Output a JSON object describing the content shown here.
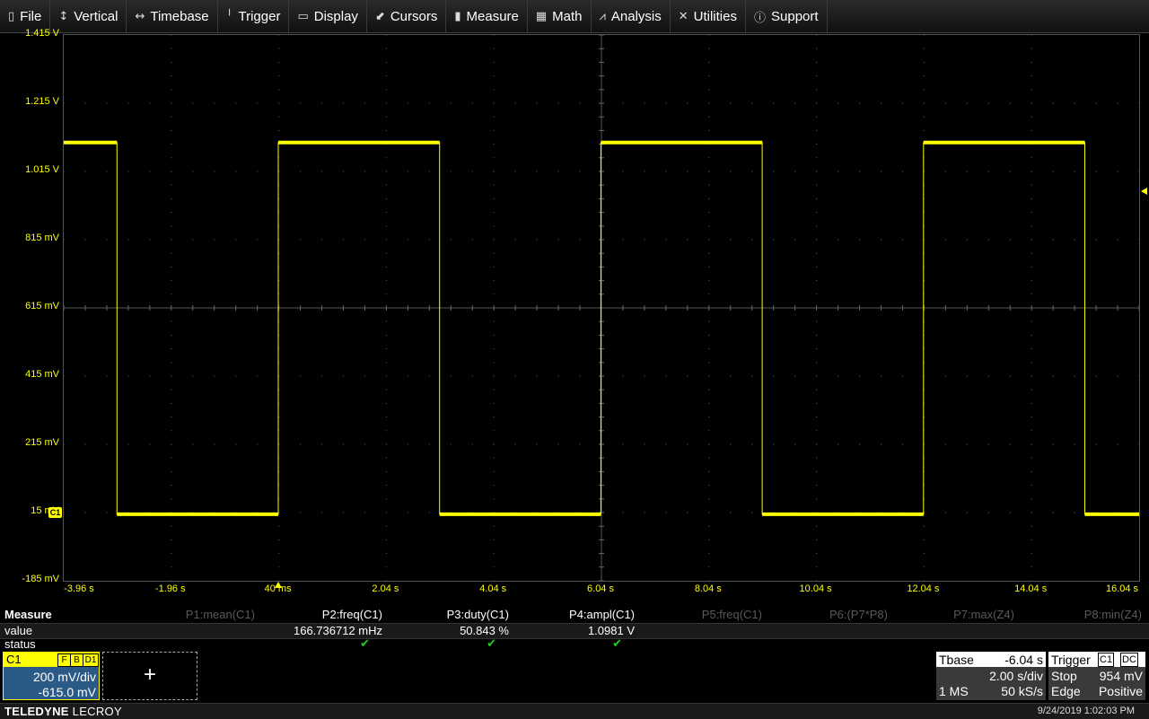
{
  "menu": [
    {
      "label": "File",
      "icon": "clipboard-icon",
      "glyph": "▯"
    },
    {
      "label": "Vertical",
      "icon": "vertical-arrows-icon",
      "glyph": "↕"
    },
    {
      "label": "Timebase",
      "icon": "horizontal-arrows-icon",
      "glyph": "↔"
    },
    {
      "label": "Trigger",
      "icon": "trigger-icon",
      "glyph": "╵"
    },
    {
      "label": "Display",
      "icon": "display-icon",
      "glyph": "▭"
    },
    {
      "label": "Cursors",
      "icon": "cursor-icon",
      "glyph": "⬋"
    },
    {
      "label": "Measure",
      "icon": "measure-icon",
      "glyph": "▮"
    },
    {
      "label": "Math",
      "icon": "calculator-icon",
      "glyph": "▦"
    },
    {
      "label": "Analysis",
      "icon": "analysis-chart-icon",
      "glyph": "⩘"
    },
    {
      "label": "Utilities",
      "icon": "wrench-icon",
      "glyph": "✕"
    },
    {
      "label": "Support",
      "icon": "info-icon",
      "glyph": "ⓘ"
    }
  ],
  "chart_data": {
    "type": "line",
    "y_tick_labels": [
      "1.415 V",
      "1.215 V",
      "1.015 V",
      "815 mV",
      "615 mV",
      "415 mV",
      "215 mV",
      "15 mV",
      "-185 mV"
    ],
    "x_tick_labels": [
      "-3.96 s",
      "-1.96 s",
      "40 ms",
      "2.04 s",
      "4.04 s",
      "6.04 s",
      "8.04 s",
      "10.04 s",
      "12.04 s",
      "14.04 s",
      "16.04 s"
    ],
    "xlim": [
      -3.96,
      16.04
    ],
    "ylim": [
      -0.185,
      1.415
    ],
    "series": [
      {
        "color": "#ffff00",
        "x": [
          -3.96,
          -2.97,
          -2.97,
          0.03,
          0.03,
          3.03,
          3.03,
          6.03,
          6.03,
          9.03,
          9.03,
          12.03,
          12.03,
          15.03,
          15.03,
          16.04
        ],
        "y": [
          1.1,
          1.1,
          0.01,
          0.01,
          1.1,
          1.1,
          0.01,
          0.01,
          1.1,
          1.1,
          0.01,
          0.01,
          1.1,
          1.1,
          0.01,
          0.01
        ]
      }
    ],
    "grid": true,
    "trace_color": "#ffff00"
  },
  "markers": {
    "channel_offset_label": "C1"
  },
  "measure": {
    "title": "Measure",
    "row_value_label": "value",
    "row_status_label": "status",
    "params": [
      {
        "name": "P1:mean(C1)",
        "value": "",
        "status": false,
        "active": false
      },
      {
        "name": "P2:freq(C1)",
        "value": "166.736712 mHz",
        "status": true,
        "active": true
      },
      {
        "name": "P3:duty(C1)",
        "value": "50.843 %",
        "status": true,
        "active": true
      },
      {
        "name": "P4:ampl(C1)",
        "value": "1.0981 V",
        "status": true,
        "active": true
      },
      {
        "name": "P5:freq(C1)",
        "value": "",
        "status": false,
        "active": false
      },
      {
        "name": "P6:(P7*P8)",
        "value": "",
        "status": false,
        "active": false
      },
      {
        "name": "P7:max(Z4)",
        "value": "",
        "status": false,
        "active": false
      },
      {
        "name": "P8:min(Z4)",
        "value": "",
        "status": false,
        "active": false
      }
    ],
    "check_glyph": "✔"
  },
  "channel": {
    "name": "C1",
    "flags": [
      "F",
      "B",
      "D1"
    ],
    "vdiv": "200 mV/div",
    "offset": "-615.0 mV",
    "add_label": "+"
  },
  "timebase": {
    "title": "Tbase",
    "delay": "-6.04 s",
    "tdiv": "2.00 s/div",
    "points": "1 MS",
    "rate": "50 kS/s"
  },
  "trigger": {
    "title": "Trigger",
    "source": "C1",
    "coupling": "DC",
    "mode": "Stop",
    "level": "954 mV",
    "type": "Edge",
    "slope": "Positive"
  },
  "footer": {
    "brand_bold": "TELEDYNE",
    "brand_light": "LECROY",
    "datetime": "9/24/2019 1:02:03 PM"
  }
}
